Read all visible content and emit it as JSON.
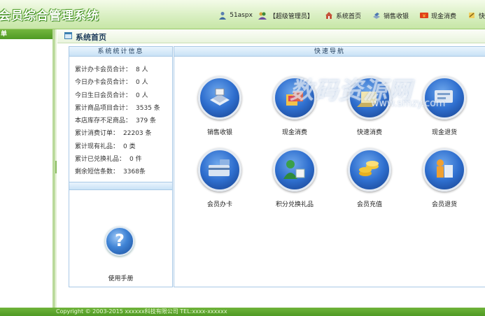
{
  "header": {
    "app_title": "会员综合管理系统",
    "user": "51aspx",
    "role": "【超级管理员】",
    "nav": [
      {
        "label": "系统首页",
        "icon": "home-icon"
      },
      {
        "label": "销售收银",
        "icon": "cashier-icon"
      },
      {
        "label": "现金消费",
        "icon": "cash-icon"
      },
      {
        "label": "快",
        "icon": "fast-icon"
      }
    ]
  },
  "sidebar": {
    "title": "单"
  },
  "main": {
    "title": "系统首页"
  },
  "stats": {
    "title": "系统统计信息",
    "rows": [
      {
        "label": "累计办卡会员合计：",
        "value": "8 人"
      },
      {
        "label": "今日办卡会员合计：",
        "value": "0 人"
      },
      {
        "label": "今日生日会员合计：",
        "value": "0 人"
      },
      {
        "label": "累计商品项目合计：",
        "value": "3535 条"
      },
      {
        "label": "本店库存不足商品：",
        "value": "379 条"
      },
      {
        "label": "累计消费订单：",
        "value": "22203 条"
      },
      {
        "label": "累计现有礼品：",
        "value": "0 类"
      },
      {
        "label": "累计已兑换礼品：",
        "value": "0 件"
      },
      {
        "label": "剩余短信条数：",
        "value": "3368条"
      }
    ],
    "help_label": "使用手册"
  },
  "quicknav": {
    "title": "快速导航",
    "items": [
      {
        "label": "销售收银",
        "icon": "cash-register-icon"
      },
      {
        "label": "现金消费",
        "icon": "shopping-bag-icon"
      },
      {
        "label": "快速消费",
        "icon": "quick-consume-icon"
      },
      {
        "label": "现金退货",
        "icon": "cash-return-icon"
      },
      {
        "label": "会员办卡",
        "icon": "member-card-icon"
      },
      {
        "label": "积分兑换礼品",
        "icon": "points-gift-icon"
      },
      {
        "label": "会员充值",
        "icon": "coins-recharge-icon"
      },
      {
        "label": "会员退货",
        "icon": "member-return-icon"
      }
    ]
  },
  "watermark": {
    "main": "数码资源网",
    "sub": "www.smzy.com"
  },
  "footer": {
    "text": "Copyright © 2003-2015 xxxxxx科技有限公司 TEL:xxxx-xxxxxx"
  },
  "colors": {
    "header_green": "#c7e6a6",
    "accent_blue": "#2f6fcf",
    "footer_green": "#4f9a24"
  }
}
